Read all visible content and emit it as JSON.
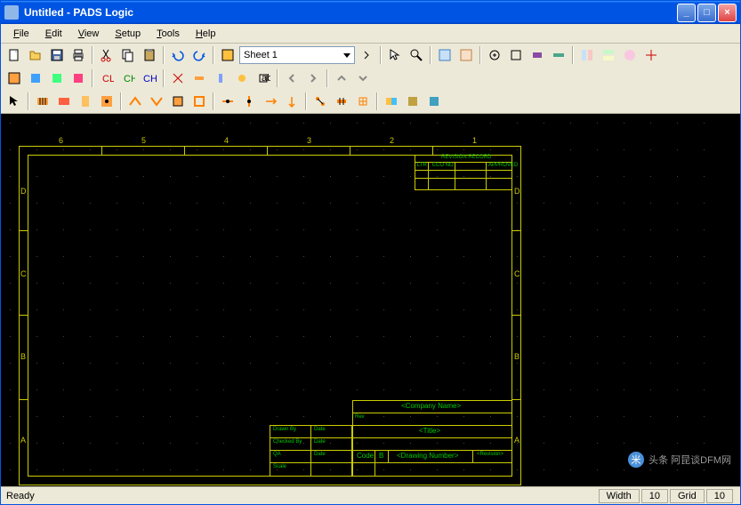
{
  "titlebar": {
    "text": "Untitled - PADS Logic"
  },
  "winbuttons": {
    "min": "_",
    "max": "□",
    "close": "×"
  },
  "menu": {
    "file": "File",
    "file_u": "F",
    "edit": "Edit",
    "edit_u": "E",
    "view": "View",
    "view_u": "V",
    "setup": "Setup",
    "setup_u": "S",
    "tools": "Tools",
    "tools_u": "T",
    "help": "Help",
    "help_u": "H"
  },
  "sheet": {
    "label": "Sheet 1"
  },
  "schematic": {
    "cols": [
      "6",
      "5",
      "4",
      "3",
      "2",
      "1"
    ],
    "rows": [
      "D",
      "C",
      "B",
      "A"
    ],
    "title_block": {
      "company": "<Company Name>",
      "title": "<Title>",
      "code": "Code",
      "code_val": "B",
      "drawing": "<Drawing Number>",
      "revision": "<Revision>",
      "scale": "Scale",
      "drawn": "Drawn By",
      "checked": "Checked By",
      "qa": "QA",
      "date": "Date",
      "rev": "Rev",
      "revisions": "REVISION RECORD",
      "ltr": "LTR",
      "eco": "ECO NO",
      "approved": "APPROVED"
    }
  },
  "status": {
    "ready": "Ready",
    "width": "Width",
    "width_val": "10",
    "grid": "Grid",
    "grid_val": "10"
  },
  "watermark": {
    "text": "头条  阿昆谈DFM网"
  }
}
